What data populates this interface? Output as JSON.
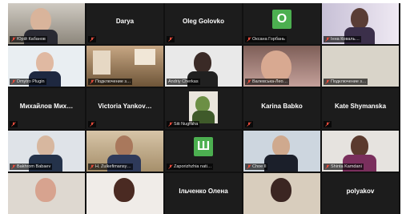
{
  "participants": [
    {
      "name": "Юрій Кабанов",
      "type": "video"
    },
    {
      "name": "Darya",
      "type": "name"
    },
    {
      "name": "Oleg Golovko",
      "type": "name"
    },
    {
      "name": "Оксана Горбань",
      "type": "avatar",
      "initial": "O",
      "color": "#4caf50"
    },
    {
      "name": "Інна Коваль…",
      "type": "video"
    },
    {
      "name": "Dmytro Plugin",
      "type": "video"
    },
    {
      "name": "Подключение з…",
      "type": "video"
    },
    {
      "name": "Andriy Cherkas",
      "type": "video",
      "speaking": true
    },
    {
      "name": "Валевська-Лео…",
      "type": "video"
    },
    {
      "name": "Подключение з…",
      "type": "video"
    },
    {
      "name": "Михайлов Мих…",
      "type": "name"
    },
    {
      "name": "Victoria Yankov…",
      "type": "name"
    },
    {
      "name": "Siti Nugraha",
      "type": "video"
    },
    {
      "name": "Karina Babko",
      "type": "name"
    },
    {
      "name": "Kate Shymanska",
      "type": "name"
    },
    {
      "name": "Bakhrom Babaev",
      "type": "video"
    },
    {
      "name": "H. Zulkefimansy…",
      "type": "video"
    },
    {
      "name": "Zaporizhzhia nati…",
      "type": "avatar",
      "initial": "Ш",
      "color": "#4caf50"
    },
    {
      "name": "Choe Il",
      "type": "video"
    },
    {
      "name": "Shinta Kamdani",
      "type": "video"
    },
    {
      "name": "",
      "type": "video"
    },
    {
      "name": "",
      "type": "video"
    },
    {
      "name": "Ільченко Олена",
      "type": "name"
    },
    {
      "name": "",
      "type": "video"
    },
    {
      "name": "polyakov",
      "type": "name"
    }
  ]
}
